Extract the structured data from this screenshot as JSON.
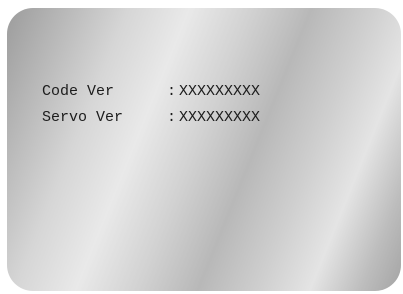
{
  "info": {
    "rows": [
      {
        "label": "Code Ver",
        "separator": ":",
        "value": "XXXXXXXXX"
      },
      {
        "label": "Servo Ver",
        "separator": ":",
        "value": "XXXXXXXXX"
      }
    ]
  },
  "colors": {
    "text": "#1c1c1c",
    "panel_base": "#c8c8c8"
  }
}
